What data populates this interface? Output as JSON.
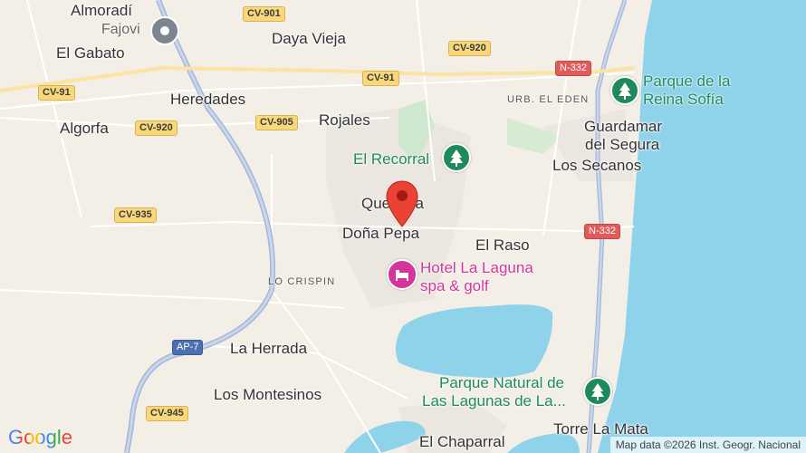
{
  "map": {
    "places": {
      "almoradi": "Almoradí",
      "el_gabato": "El Gabato",
      "daya_vieja": "Daya Vieja",
      "heredades": "Heredades",
      "algorfa": "Algorfa",
      "rojales": "Rojales",
      "guardamar": "Guardamar",
      "del_segura": "del Segura",
      "los_secanos": "Los Secanos",
      "quesada": "Quesada",
      "dona_pepa": "Doña Pepa",
      "el_raso": "El Raso",
      "la_herrada": "La Herrada",
      "los_montesinos": "Los Montesinos",
      "torre_la_mata": "Torre La Mata",
      "el_chaparral": "El Chaparral"
    },
    "districts": {
      "urb_el_eden": "URB. EL EDEN",
      "lo_crispin": "LO CRISPIN"
    },
    "roads": {
      "cv901": "CV-901",
      "cv920_top": "CV-920",
      "cv91_left": "CV-91",
      "cv91_center": "CV-91",
      "n332_top": "N-332",
      "cv920_left": "CV-920",
      "cv905": "CV-905",
      "cv935": "CV-935",
      "n332_right": "N-332",
      "ap7": "AP-7",
      "cv945": "CV-945"
    },
    "parks": {
      "reina_sofia_line1": "Parque de la",
      "reina_sofia_line2": "Reina Sofía",
      "el_recorral": "El Recorral",
      "lagunas_line1": "Parque Natural de",
      "lagunas_line2": "Las Lagunas de La..."
    },
    "poi": {
      "hotel_line1": "Hotel La Laguna",
      "hotel_line2": "spa & golf",
      "fajovi": "Fajovi"
    },
    "footer": {
      "logo": "Google",
      "attribution": "Map data ©2026 Inst. Geogr. Nacional"
    },
    "colors": {
      "sea": "#8fd3ea",
      "land": "#f3efe6",
      "park_green": "#1e8a5c",
      "poi_pink": "#d6349b",
      "marker_red": "#ea4335",
      "road_yellow": "#f8d87a"
    },
    "icons": {
      "marker": "location-pin-icon",
      "park": "tree-icon",
      "hotel": "bed-icon",
      "place": "grey-place-pin-icon"
    }
  }
}
